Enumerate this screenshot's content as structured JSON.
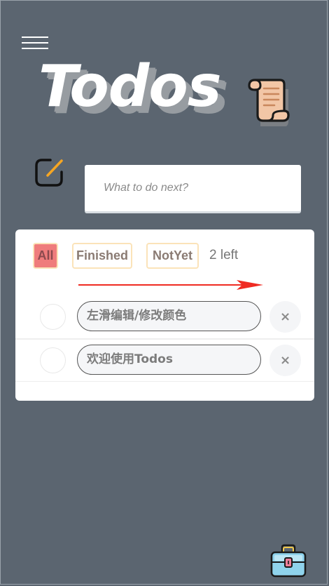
{
  "app": {
    "title": "Todos"
  },
  "input": {
    "placeholder": "What to do next?"
  },
  "filters": [
    {
      "label": "All",
      "active": true
    },
    {
      "label": "Finished",
      "active": false
    },
    {
      "label": "NotYet",
      "active": false
    }
  ],
  "left_count": "2 left",
  "todos": [
    {
      "text": "左滑编辑/修改颜色",
      "done": false,
      "delete_label": "×"
    },
    {
      "text": "欢迎使用Todos",
      "done": false,
      "delete_label": "×"
    }
  ],
  "icons": {
    "menu": "hamburger-menu-icon",
    "logo": "scroll-icon",
    "edit": "edit-pencil-icon",
    "toolbox": "toolbox-icon"
  },
  "colors": {
    "background": "#5b6570",
    "active_filter": "#ef7c7c",
    "filter_border": "#fbe3b9",
    "arrow": "#ef2b22"
  }
}
